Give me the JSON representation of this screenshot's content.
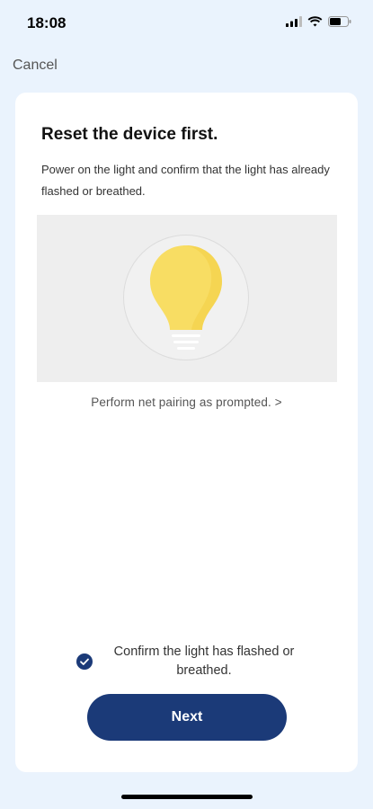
{
  "status_bar": {
    "time": "18:08",
    "icons": [
      "cellular-signal-icon",
      "wifi-icon",
      "battery-icon"
    ]
  },
  "nav": {
    "cancel_label": "Cancel"
  },
  "card": {
    "title": "Reset the device first.",
    "description": "Power on the light and confirm that the light has already flashed or breathed.",
    "illustration_icon": "light-bulb-icon",
    "pairing_link": "Perform net pairing as prompted. >",
    "confirm_checked": true,
    "confirm_label": "Confirm the light has flashed or breathed.",
    "next_label": "Next"
  },
  "colors": {
    "background": "#eaf3fd",
    "accent": "#1b3a78",
    "bulb": "#f8dd63"
  }
}
